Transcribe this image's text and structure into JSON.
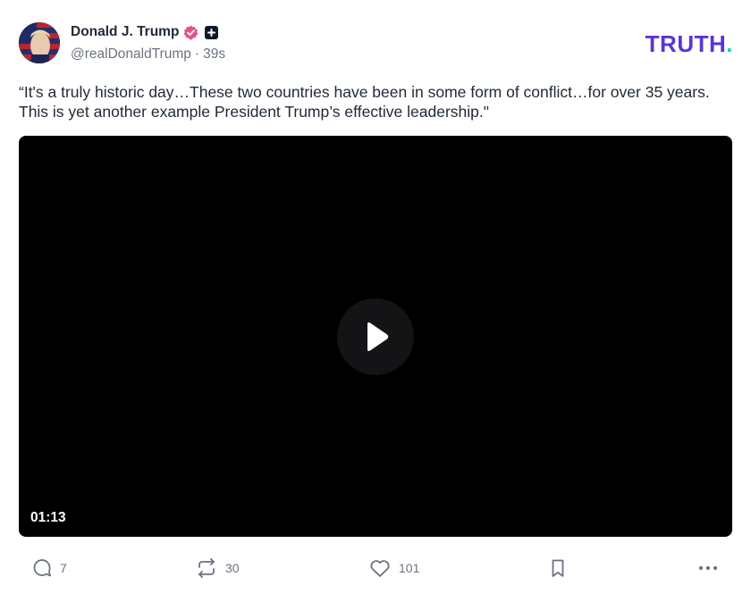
{
  "author": {
    "display_name": "Donald J. Trump",
    "handle": "@realDonaldTrump",
    "separator": "·",
    "time_ago": "39s"
  },
  "brand": {
    "logo_text": "TRUTH",
    "logo_dot": ".",
    "colors": {
      "primary": "#5b35d5",
      "accent": "#1fd0c1",
      "verified": "#e2528b"
    }
  },
  "post": {
    "text": "“It's a truly historic day…These two countries have been in some form of conflict…for over 35 years. This is yet another example President Trump’s effective leadership.\""
  },
  "video": {
    "duration": "01:13",
    "icon": "play-icon"
  },
  "actions": {
    "reply_count": "7",
    "retruth_count": "30",
    "like_count": "101",
    "icons": [
      "reply-icon",
      "retruth-icon",
      "heart-icon",
      "bookmark-icon",
      "more-icon"
    ]
  }
}
